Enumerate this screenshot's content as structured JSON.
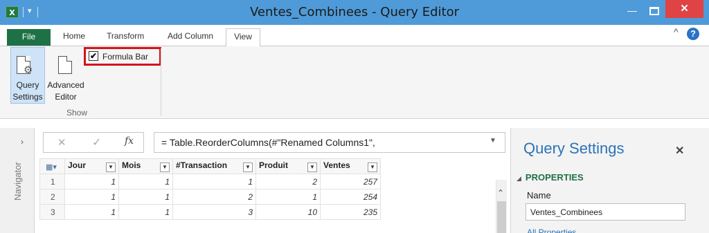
{
  "window": {
    "title": "Ventes_Combinees - Query Editor",
    "app_icon": "excel-icon",
    "minimize": "—",
    "close": "✕"
  },
  "ribbon": {
    "tabs": [
      {
        "label": "File"
      },
      {
        "label": "Home"
      },
      {
        "label": "Transform"
      },
      {
        "label": "Add Column"
      },
      {
        "label": "View"
      }
    ],
    "active_tab": "View",
    "query_settings_label_1": "Query",
    "query_settings_label_2": "Settings",
    "advanced_editor_label_1": "Advanced",
    "advanced_editor_label_2": "Editor",
    "group_label": "Show",
    "formula_bar_label": "Formula Bar",
    "formula_bar_checked": true,
    "help": "?",
    "collapse": "^"
  },
  "navigator": {
    "label": "Navigator",
    "arrow": "›"
  },
  "formula_bar": {
    "cancel": "✕",
    "confirm": "✓",
    "fx": "fx",
    "formula": "= Table.ReorderColumns(#\"Renamed Columns1\","
  },
  "grid": {
    "columns": [
      "Jour",
      "Mois",
      "#Transaction",
      "Produit",
      "Ventes"
    ],
    "rows": [
      {
        "n": "1",
        "cells": [
          "1",
          "1",
          "1",
          "2",
          "257"
        ]
      },
      {
        "n": "2",
        "cells": [
          "1",
          "1",
          "2",
          "1",
          "254"
        ]
      },
      {
        "n": "3",
        "cells": [
          "1",
          "1",
          "3",
          "10",
          "235"
        ]
      }
    ]
  },
  "query_settings": {
    "title": "Query Settings",
    "close": "✕",
    "properties_heading": "PROPERTIES",
    "name_label": "Name",
    "name_value": "Ventes_Combinees",
    "all_properties_link": "All Properties"
  },
  "colors": {
    "titlebar": "#4f9bd9",
    "file_tab": "#1e7145",
    "close_button": "#e04343",
    "highlight_box": "#d4131a",
    "accent_blue": "#2a73b8"
  }
}
